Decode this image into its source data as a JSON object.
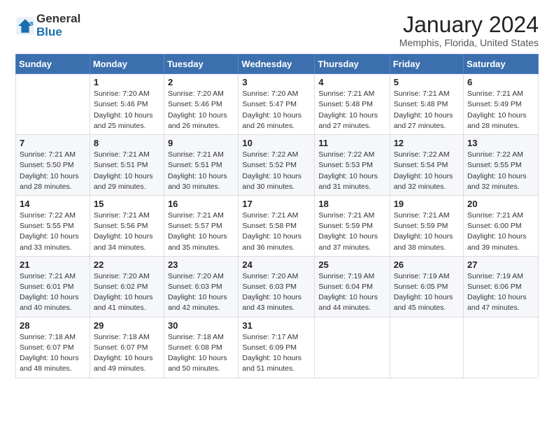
{
  "header": {
    "logo_general": "General",
    "logo_blue": "Blue",
    "month_title": "January 2024",
    "location": "Memphis, Florida, United States"
  },
  "weekdays": [
    "Sunday",
    "Monday",
    "Tuesday",
    "Wednesday",
    "Thursday",
    "Friday",
    "Saturday"
  ],
  "weeks": [
    [
      {
        "day": "",
        "info": ""
      },
      {
        "day": "1",
        "info": "Sunrise: 7:20 AM\nSunset: 5:46 PM\nDaylight: 10 hours\nand 25 minutes."
      },
      {
        "day": "2",
        "info": "Sunrise: 7:20 AM\nSunset: 5:46 PM\nDaylight: 10 hours\nand 26 minutes."
      },
      {
        "day": "3",
        "info": "Sunrise: 7:20 AM\nSunset: 5:47 PM\nDaylight: 10 hours\nand 26 minutes."
      },
      {
        "day": "4",
        "info": "Sunrise: 7:21 AM\nSunset: 5:48 PM\nDaylight: 10 hours\nand 27 minutes."
      },
      {
        "day": "5",
        "info": "Sunrise: 7:21 AM\nSunset: 5:48 PM\nDaylight: 10 hours\nand 27 minutes."
      },
      {
        "day": "6",
        "info": "Sunrise: 7:21 AM\nSunset: 5:49 PM\nDaylight: 10 hours\nand 28 minutes."
      }
    ],
    [
      {
        "day": "7",
        "info": "Sunrise: 7:21 AM\nSunset: 5:50 PM\nDaylight: 10 hours\nand 28 minutes."
      },
      {
        "day": "8",
        "info": "Sunrise: 7:21 AM\nSunset: 5:51 PM\nDaylight: 10 hours\nand 29 minutes."
      },
      {
        "day": "9",
        "info": "Sunrise: 7:21 AM\nSunset: 5:51 PM\nDaylight: 10 hours\nand 30 minutes."
      },
      {
        "day": "10",
        "info": "Sunrise: 7:22 AM\nSunset: 5:52 PM\nDaylight: 10 hours\nand 30 minutes."
      },
      {
        "day": "11",
        "info": "Sunrise: 7:22 AM\nSunset: 5:53 PM\nDaylight: 10 hours\nand 31 minutes."
      },
      {
        "day": "12",
        "info": "Sunrise: 7:22 AM\nSunset: 5:54 PM\nDaylight: 10 hours\nand 32 minutes."
      },
      {
        "day": "13",
        "info": "Sunrise: 7:22 AM\nSunset: 5:55 PM\nDaylight: 10 hours\nand 32 minutes."
      }
    ],
    [
      {
        "day": "14",
        "info": "Sunrise: 7:22 AM\nSunset: 5:55 PM\nDaylight: 10 hours\nand 33 minutes."
      },
      {
        "day": "15",
        "info": "Sunrise: 7:21 AM\nSunset: 5:56 PM\nDaylight: 10 hours\nand 34 minutes."
      },
      {
        "day": "16",
        "info": "Sunrise: 7:21 AM\nSunset: 5:57 PM\nDaylight: 10 hours\nand 35 minutes."
      },
      {
        "day": "17",
        "info": "Sunrise: 7:21 AM\nSunset: 5:58 PM\nDaylight: 10 hours\nand 36 minutes."
      },
      {
        "day": "18",
        "info": "Sunrise: 7:21 AM\nSunset: 5:59 PM\nDaylight: 10 hours\nand 37 minutes."
      },
      {
        "day": "19",
        "info": "Sunrise: 7:21 AM\nSunset: 5:59 PM\nDaylight: 10 hours\nand 38 minutes."
      },
      {
        "day": "20",
        "info": "Sunrise: 7:21 AM\nSunset: 6:00 PM\nDaylight: 10 hours\nand 39 minutes."
      }
    ],
    [
      {
        "day": "21",
        "info": "Sunrise: 7:21 AM\nSunset: 6:01 PM\nDaylight: 10 hours\nand 40 minutes."
      },
      {
        "day": "22",
        "info": "Sunrise: 7:20 AM\nSunset: 6:02 PM\nDaylight: 10 hours\nand 41 minutes."
      },
      {
        "day": "23",
        "info": "Sunrise: 7:20 AM\nSunset: 6:03 PM\nDaylight: 10 hours\nand 42 minutes."
      },
      {
        "day": "24",
        "info": "Sunrise: 7:20 AM\nSunset: 6:03 PM\nDaylight: 10 hours\nand 43 minutes."
      },
      {
        "day": "25",
        "info": "Sunrise: 7:19 AM\nSunset: 6:04 PM\nDaylight: 10 hours\nand 44 minutes."
      },
      {
        "day": "26",
        "info": "Sunrise: 7:19 AM\nSunset: 6:05 PM\nDaylight: 10 hours\nand 45 minutes."
      },
      {
        "day": "27",
        "info": "Sunrise: 7:19 AM\nSunset: 6:06 PM\nDaylight: 10 hours\nand 47 minutes."
      }
    ],
    [
      {
        "day": "28",
        "info": "Sunrise: 7:18 AM\nSunset: 6:07 PM\nDaylight: 10 hours\nand 48 minutes."
      },
      {
        "day": "29",
        "info": "Sunrise: 7:18 AM\nSunset: 6:07 PM\nDaylight: 10 hours\nand 49 minutes."
      },
      {
        "day": "30",
        "info": "Sunrise: 7:18 AM\nSunset: 6:08 PM\nDaylight: 10 hours\nand 50 minutes."
      },
      {
        "day": "31",
        "info": "Sunrise: 7:17 AM\nSunset: 6:09 PM\nDaylight: 10 hours\nand 51 minutes."
      },
      {
        "day": "",
        "info": ""
      },
      {
        "day": "",
        "info": ""
      },
      {
        "day": "",
        "info": ""
      }
    ]
  ]
}
